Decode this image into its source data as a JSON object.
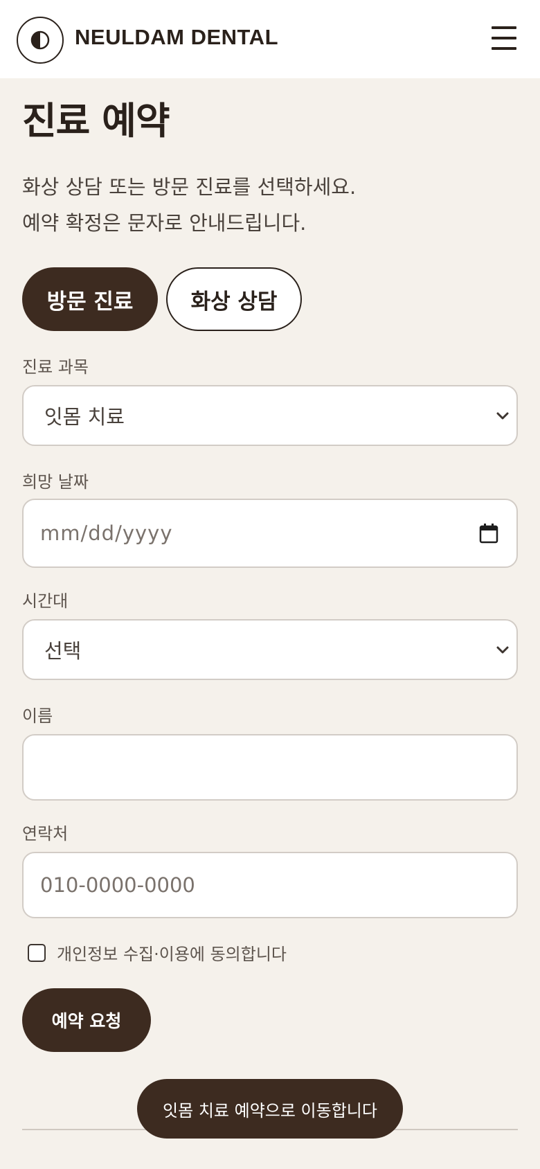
{
  "header": {
    "brand": "NEULDAM DENTAL",
    "logo_icon": "half-moon-icon",
    "menu_icon": "hamburger-menu-icon"
  },
  "page": {
    "title": "진료 예약",
    "intro_line1": "화상 상담 또는 방문 진료를 선택하세요.",
    "intro_line2": "예약 확정은 문자로 안내드립니다."
  },
  "mode_toggle": {
    "options": [
      "방문 진료",
      "화상 상담"
    ],
    "selected": "방문 진료"
  },
  "form": {
    "department": {
      "label": "진료 과목",
      "value": "잇몸 치료"
    },
    "date": {
      "label": "희망 날짜",
      "placeholder": "mm/dd/yyyy"
    },
    "time_slot": {
      "label": "시간대",
      "value": "선택"
    },
    "name": {
      "label": "이름",
      "value": ""
    },
    "phone": {
      "label": "연락처",
      "placeholder": "010-0000-0000"
    },
    "consent": {
      "label": "개인정보 수집·이용에 동의합니다",
      "checked": false
    },
    "submit_label": "예약 요청"
  },
  "toast": {
    "message": "잇몸 치료 예약으로 이동합니다"
  },
  "colors": {
    "background": "#f5f1eb",
    "primary": "#3d2b20",
    "text": "#2a211b",
    "field_border": "#d2ccc6"
  }
}
